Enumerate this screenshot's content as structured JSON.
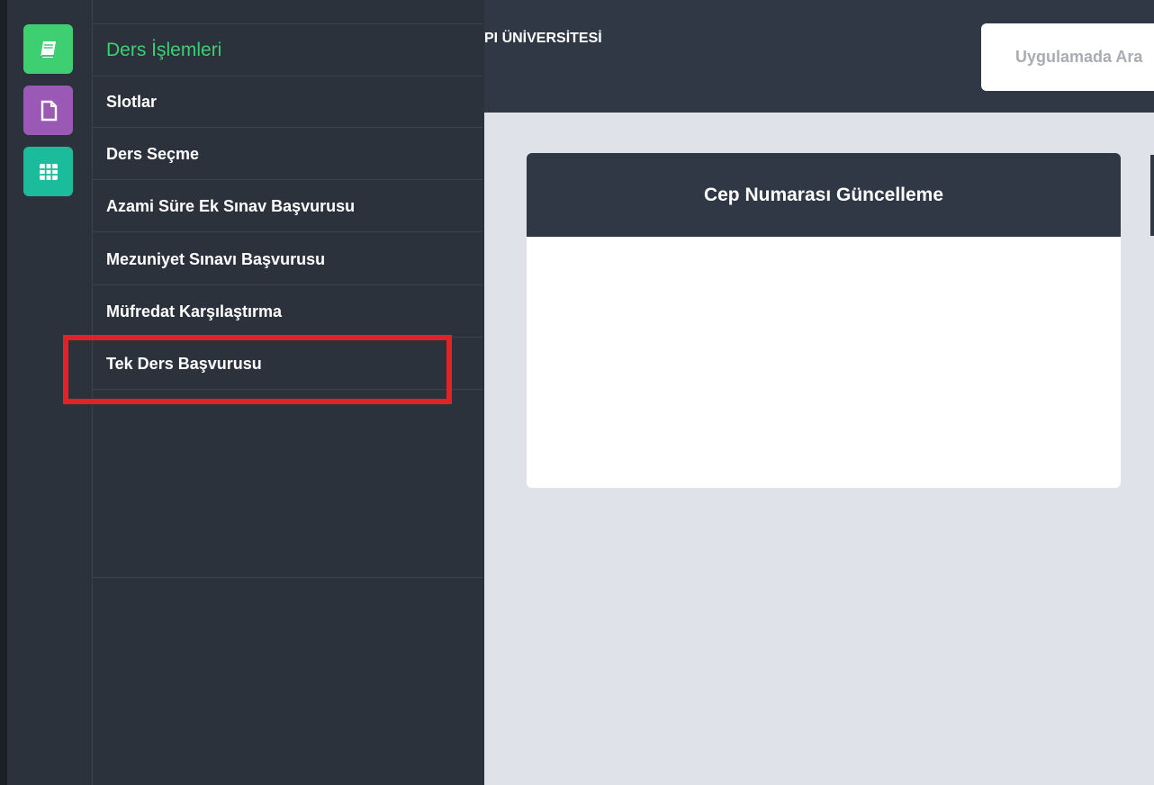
{
  "sidebar": {
    "apps": [
      {
        "icon": "book-icon",
        "color": "#3fcf73"
      },
      {
        "icon": "document-icon",
        "color": "#9b59b6"
      },
      {
        "icon": "grid-icon",
        "color": "#1abc9c"
      }
    ],
    "section_title": "Ders İşlemleri",
    "items": [
      {
        "label": "Slotlar"
      },
      {
        "label": "Ders Seçme"
      },
      {
        "label": "Azami Süre Ek Sınav Başvurusu"
      },
      {
        "label": "Mezuniyet Sınavı Başvurusu"
      },
      {
        "label": "Müfredat Karşılaştırma"
      },
      {
        "label": "Tek Ders Başvurusu"
      }
    ],
    "highlighted_item": "Tek Ders Başvurusu",
    "highlight_color": "#e42127"
  },
  "header": {
    "university_title": "PI ÜNİVERSİTESİ",
    "search_placeholder": "Uygulamada Ara"
  },
  "main": {
    "card_title": "Cep Numarası Güncelleme"
  }
}
